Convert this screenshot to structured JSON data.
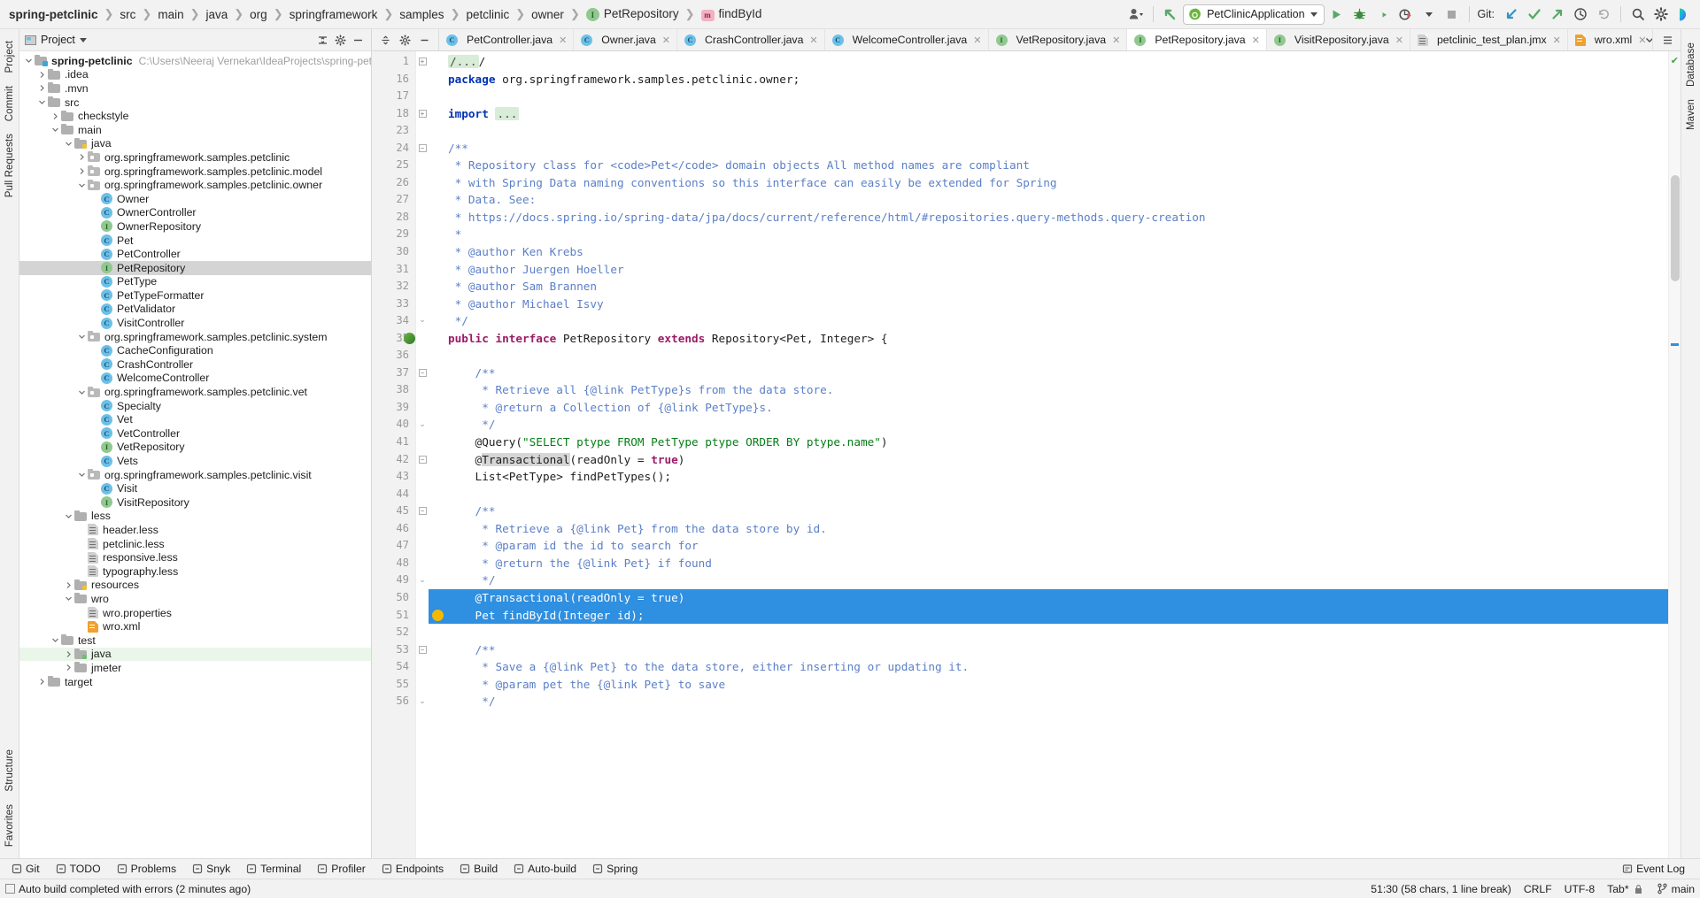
{
  "window": {
    "breadcrumb": [
      {
        "label": "spring-petclinic",
        "icon": "",
        "root": true
      },
      {
        "label": "src",
        "icon": ""
      },
      {
        "label": "main",
        "icon": ""
      },
      {
        "label": "java",
        "icon": ""
      },
      {
        "label": "org",
        "icon": ""
      },
      {
        "label": "springframework",
        "icon": ""
      },
      {
        "label": "samples",
        "icon": ""
      },
      {
        "label": "petclinic",
        "icon": ""
      },
      {
        "label": "owner",
        "icon": ""
      },
      {
        "label": "PetRepository",
        "icon": "interface-icon"
      },
      {
        "label": "findById",
        "icon": "method-icon"
      }
    ],
    "run_config": "PetClinicApplication",
    "git_label": "Git:"
  },
  "toolbar_icons": {
    "user_account": "account-icon",
    "update_project": "update-project-icon",
    "run": "run-icon",
    "debug": "debug-icon",
    "run_with_coverage": "run-coverage-icon",
    "profile": "profiler-icon",
    "stop": "stop-icon",
    "git_update": "git-update-icon",
    "git_commit": "git-commit-icon",
    "git_push": "git-push-icon",
    "git_history": "git-history-icon",
    "git_rollback": "git-rollback-icon",
    "search_everywhere": "search-icon",
    "settings": "gear-icon",
    "ide_assistant": "ide-assistant-icon"
  },
  "left_rail": {
    "items": [
      "Project",
      "Commit",
      "Pull Requests"
    ],
    "bottom_items": [
      "Structure",
      "Favorites"
    ]
  },
  "right_rail": {
    "items": [
      "Database",
      "Maven"
    ]
  },
  "project_panel": {
    "title": "Project",
    "tree": [
      {
        "indent": 0,
        "arrow": "down",
        "icon": "module",
        "label": "spring-petclinic",
        "bold": true,
        "path": "C:\\Users\\Neeraj Vernekar\\IdeaProjects\\spring-petclinic"
      },
      {
        "indent": 1,
        "arrow": "right",
        "icon": "folder",
        "label": ".idea"
      },
      {
        "indent": 1,
        "arrow": "right",
        "icon": "folder",
        "label": ".mvn"
      },
      {
        "indent": 1,
        "arrow": "down",
        "icon": "folder",
        "label": "src"
      },
      {
        "indent": 2,
        "arrow": "right",
        "icon": "folder",
        "label": "checkstyle"
      },
      {
        "indent": 2,
        "arrow": "down",
        "icon": "folder",
        "label": "main"
      },
      {
        "indent": 3,
        "arrow": "down",
        "icon": "folder-source",
        "label": "java"
      },
      {
        "indent": 4,
        "arrow": "right",
        "icon": "package",
        "label": "org.springframework.samples.petclinic"
      },
      {
        "indent": 4,
        "arrow": "right",
        "icon": "package",
        "label": "org.springframework.samples.petclinic.model"
      },
      {
        "indent": 4,
        "arrow": "down",
        "icon": "package",
        "label": "org.springframework.samples.petclinic.owner"
      },
      {
        "indent": 5,
        "arrow": "none",
        "icon": "class",
        "label": "Owner"
      },
      {
        "indent": 5,
        "arrow": "none",
        "icon": "class",
        "label": "OwnerController"
      },
      {
        "indent": 5,
        "arrow": "none",
        "icon": "interface",
        "label": "OwnerRepository"
      },
      {
        "indent": 5,
        "arrow": "none",
        "icon": "class",
        "label": "Pet"
      },
      {
        "indent": 5,
        "arrow": "none",
        "icon": "class",
        "label": "PetController"
      },
      {
        "indent": 5,
        "arrow": "none",
        "icon": "interface",
        "label": "PetRepository",
        "selected": true
      },
      {
        "indent": 5,
        "arrow": "none",
        "icon": "class",
        "label": "PetType"
      },
      {
        "indent": 5,
        "arrow": "none",
        "icon": "class",
        "label": "PetTypeFormatter"
      },
      {
        "indent": 5,
        "arrow": "none",
        "icon": "class",
        "label": "PetValidator"
      },
      {
        "indent": 5,
        "arrow": "none",
        "icon": "class",
        "label": "VisitController"
      },
      {
        "indent": 4,
        "arrow": "down",
        "icon": "package",
        "label": "org.springframework.samples.petclinic.system"
      },
      {
        "indent": 5,
        "arrow": "none",
        "icon": "class",
        "label": "CacheConfiguration"
      },
      {
        "indent": 5,
        "arrow": "none",
        "icon": "class",
        "label": "CrashController"
      },
      {
        "indent": 5,
        "arrow": "none",
        "icon": "class",
        "label": "WelcomeController"
      },
      {
        "indent": 4,
        "arrow": "down",
        "icon": "package",
        "label": "org.springframework.samples.petclinic.vet"
      },
      {
        "indent": 5,
        "arrow": "none",
        "icon": "class",
        "label": "Specialty"
      },
      {
        "indent": 5,
        "arrow": "none",
        "icon": "class",
        "label": "Vet"
      },
      {
        "indent": 5,
        "arrow": "none",
        "icon": "class",
        "label": "VetController"
      },
      {
        "indent": 5,
        "arrow": "none",
        "icon": "interface",
        "label": "VetRepository"
      },
      {
        "indent": 5,
        "arrow": "none",
        "icon": "class",
        "label": "Vets"
      },
      {
        "indent": 4,
        "arrow": "down",
        "icon": "package",
        "label": "org.springframework.samples.petclinic.visit"
      },
      {
        "indent": 5,
        "arrow": "none",
        "icon": "class",
        "label": "Visit"
      },
      {
        "indent": 5,
        "arrow": "none",
        "icon": "interface",
        "label": "VisitRepository"
      },
      {
        "indent": 3,
        "arrow": "down",
        "icon": "folder",
        "label": "less"
      },
      {
        "indent": 4,
        "arrow": "none",
        "icon": "file",
        "label": "header.less"
      },
      {
        "indent": 4,
        "arrow": "none",
        "icon": "file",
        "label": "petclinic.less"
      },
      {
        "indent": 4,
        "arrow": "none",
        "icon": "file",
        "label": "responsive.less"
      },
      {
        "indent": 4,
        "arrow": "none",
        "icon": "file",
        "label": "typography.less"
      },
      {
        "indent": 3,
        "arrow": "right",
        "icon": "folder-source",
        "label": "resources"
      },
      {
        "indent": 3,
        "arrow": "down",
        "icon": "folder",
        "label": "wro"
      },
      {
        "indent": 4,
        "arrow": "none",
        "icon": "file",
        "label": "wro.properties"
      },
      {
        "indent": 4,
        "arrow": "none",
        "icon": "file-xml",
        "label": "wro.xml"
      },
      {
        "indent": 2,
        "arrow": "down",
        "icon": "folder",
        "label": "test"
      },
      {
        "indent": 3,
        "arrow": "right",
        "icon": "folder-test",
        "label": "java",
        "greenbg": true
      },
      {
        "indent": 3,
        "arrow": "right",
        "icon": "folder",
        "label": "jmeter"
      },
      {
        "indent": 1,
        "arrow": "right",
        "icon": "folder",
        "label": "target"
      }
    ]
  },
  "editor_tabs": {
    "tools": [
      "collapse-all-icon",
      "settings-icon",
      "hide-icon"
    ],
    "tabs": [
      {
        "label": "PetController.java",
        "icon": "class",
        "active": false
      },
      {
        "label": "Owner.java",
        "icon": "class",
        "active": false
      },
      {
        "label": "CrashController.java",
        "icon": "class",
        "active": false
      },
      {
        "label": "WelcomeController.java",
        "icon": "class",
        "active": false
      },
      {
        "label": "VetRepository.java",
        "icon": "interface",
        "active": false
      },
      {
        "label": "PetRepository.java",
        "icon": "interface",
        "active": true
      },
      {
        "label": "VisitRepository.java",
        "icon": "interface",
        "active": false
      },
      {
        "label": "petclinic_test_plan.jmx",
        "icon": "file",
        "active": false
      },
      {
        "label": "wro.xml",
        "icon": "file-xml",
        "active": false
      }
    ]
  },
  "code": {
    "lines": [
      {
        "num": "1",
        "fold": "plus",
        "tokens": [
          {
            "t": "/...",
            "c": "fold-ph"
          },
          {
            "t": "/",
            "c": "plain"
          }
        ]
      },
      {
        "num": "16",
        "fold": "",
        "tokens": [
          {
            "t": "package",
            "c": "k"
          },
          {
            "t": " org.springframework.samples.petclinic.owner;",
            "c": "plain"
          }
        ]
      },
      {
        "num": "17",
        "fold": "",
        "tokens": []
      },
      {
        "num": "18",
        "fold": "plus",
        "tokens": [
          {
            "t": "import",
            "c": "k"
          },
          {
            "t": " ",
            "c": "plain"
          },
          {
            "t": "...",
            "c": "fold-ph"
          }
        ]
      },
      {
        "num": "23",
        "fold": "",
        "tokens": []
      },
      {
        "num": "24",
        "fold": "minus",
        "tokens": [
          {
            "t": "/**",
            "c": "cmt"
          }
        ]
      },
      {
        "num": "25",
        "fold": "",
        "tokens": [
          {
            "t": " * Repository class for <code>Pet</code> domain objects All method names are compliant",
            "c": "cmt"
          }
        ]
      },
      {
        "num": "26",
        "fold": "",
        "tokens": [
          {
            "t": " * with Spring Data naming conventions so this interface can easily be extended for Spring",
            "c": "cmt"
          }
        ]
      },
      {
        "num": "27",
        "fold": "",
        "tokens": [
          {
            "t": " * Data. See:",
            "c": "cmt"
          }
        ]
      },
      {
        "num": "28",
        "fold": "",
        "tokens": [
          {
            "t": " * https://docs.spring.io/spring-data/jpa/docs/current/reference/html/#repositories.query-methods.query-creation",
            "c": "cmt"
          }
        ]
      },
      {
        "num": "29",
        "fold": "",
        "tokens": [
          {
            "t": " *",
            "c": "cmt"
          }
        ]
      },
      {
        "num": "30",
        "fold": "",
        "tokens": [
          {
            "t": " * @author Ken Krebs",
            "c": "cmt"
          }
        ]
      },
      {
        "num": "31",
        "fold": "",
        "tokens": [
          {
            "t": " * @author Juergen Hoeller",
            "c": "cmt"
          }
        ]
      },
      {
        "num": "32",
        "fold": "",
        "tokens": [
          {
            "t": " * @author Sam Brannen",
            "c": "cmt"
          }
        ]
      },
      {
        "num": "33",
        "fold": "",
        "tokens": [
          {
            "t": " * @author Michael Isvy",
            "c": "cmt"
          }
        ]
      },
      {
        "num": "34",
        "fold": "end",
        "tokens": [
          {
            "t": " */",
            "c": "cmt"
          }
        ]
      },
      {
        "num": "35",
        "fold": "",
        "gutter_icon": "spring-bean-icon",
        "tokens": [
          {
            "t": "public interface",
            "c": "kw"
          },
          {
            "t": " PetRepository ",
            "c": "plain"
          },
          {
            "t": "extends",
            "c": "kw"
          },
          {
            "t": " Repository<Pet, Integer> {",
            "c": "plain"
          }
        ]
      },
      {
        "num": "36",
        "fold": "",
        "tokens": []
      },
      {
        "num": "37",
        "fold": "minus",
        "tokens": [
          {
            "t": "    /**",
            "c": "cmt"
          }
        ]
      },
      {
        "num": "38",
        "fold": "",
        "tokens": [
          {
            "t": "     * Retrieve all {@link PetType}s from the data store.",
            "c": "cmt"
          }
        ]
      },
      {
        "num": "39",
        "fold": "",
        "tokens": [
          {
            "t": "     * @return a Collection of {@link PetType}s.",
            "c": "cmt"
          }
        ]
      },
      {
        "num": "40",
        "fold": "end",
        "tokens": [
          {
            "t": "     */",
            "c": "cmt"
          }
        ]
      },
      {
        "num": "41",
        "fold": "",
        "tokens": [
          {
            "t": "    @Query(",
            "c": "plain"
          },
          {
            "t": "\"SELECT ptype FROM PetType ptype ORDER BY ptype.name\"",
            "c": "str"
          },
          {
            "t": ")",
            "c": "plain"
          }
        ]
      },
      {
        "num": "42",
        "fold": "minus",
        "tokens": [
          {
            "t": "    @",
            "c": "plain"
          },
          {
            "t": "Transactional",
            "c": "tx-hl"
          },
          {
            "t": "(readOnly = ",
            "c": "plain"
          },
          {
            "t": "true",
            "c": "kw"
          },
          {
            "t": ")",
            "c": "plain"
          }
        ]
      },
      {
        "num": "43",
        "fold": "",
        "tokens": [
          {
            "t": "    List<PetType> findPetTypes();",
            "c": "plain"
          }
        ]
      },
      {
        "num": "44",
        "fold": "",
        "tokens": []
      },
      {
        "num": "45",
        "fold": "minus",
        "tokens": [
          {
            "t": "    /**",
            "c": "cmt"
          }
        ]
      },
      {
        "num": "46",
        "fold": "",
        "tokens": [
          {
            "t": "     * Retrieve a {@link Pet} from the data store by id.",
            "c": "cmt"
          }
        ]
      },
      {
        "num": "47",
        "fold": "",
        "tokens": [
          {
            "t": "     * @param id the id to search for",
            "c": "cmt"
          }
        ]
      },
      {
        "num": "48",
        "fold": "",
        "tokens": [
          {
            "t": "     * @return the {@link Pet} if found",
            "c": "cmt"
          }
        ]
      },
      {
        "num": "49",
        "fold": "end",
        "tokens": [
          {
            "t": "     */",
            "c": "cmt"
          }
        ]
      },
      {
        "num": "50",
        "fold": "",
        "selected": true,
        "tokens": [
          {
            "t": "    @Transactional(readOnly = true)",
            "c": "selspan"
          }
        ]
      },
      {
        "num": "51",
        "fold": "",
        "selected": true,
        "bulb": true,
        "tokens": [
          {
            "t": "    Pet findById(Integer id);",
            "c": "selspan"
          }
        ]
      },
      {
        "num": "52",
        "fold": "",
        "tokens": []
      },
      {
        "num": "53",
        "fold": "minus",
        "tokens": [
          {
            "t": "    /**",
            "c": "cmt"
          }
        ]
      },
      {
        "num": "54",
        "fold": "",
        "tokens": [
          {
            "t": "     * Save a {@link Pet} to the data store, either inserting or updating it.",
            "c": "cmt"
          }
        ]
      },
      {
        "num": "55",
        "fold": "",
        "tokens": [
          {
            "t": "     * @param pet the {@link Pet} to save",
            "c": "cmt"
          }
        ]
      },
      {
        "num": "56",
        "fold": "end",
        "tokens": [
          {
            "t": "     */",
            "c": "cmt"
          }
        ]
      }
    ]
  },
  "tool_window_bar": {
    "left": [
      {
        "label": "Git",
        "icon": "git-icon"
      },
      {
        "label": "TODO",
        "icon": "todo-icon"
      },
      {
        "label": "Problems",
        "icon": "problems-icon"
      },
      {
        "label": "Snyk",
        "icon": "snyk-icon"
      },
      {
        "label": "Terminal",
        "icon": "terminal-icon"
      },
      {
        "label": "Profiler",
        "icon": "profiler-icon"
      },
      {
        "label": "Endpoints",
        "icon": "endpoints-icon"
      },
      {
        "label": "Build",
        "icon": "build-icon"
      },
      {
        "label": "Auto-build",
        "icon": "auto-build-icon"
      },
      {
        "label": "Spring",
        "icon": "spring-icon"
      }
    ],
    "right": [
      {
        "label": "Event Log",
        "icon": "event-log-icon"
      }
    ]
  },
  "statusbar": {
    "message": "Auto build completed with errors (2 minutes ago)",
    "caret": "51:30 (58 chars, 1 line break)",
    "line_separator": "CRLF",
    "encoding": "UTF-8",
    "indent": "Tab*",
    "branch": "main"
  }
}
